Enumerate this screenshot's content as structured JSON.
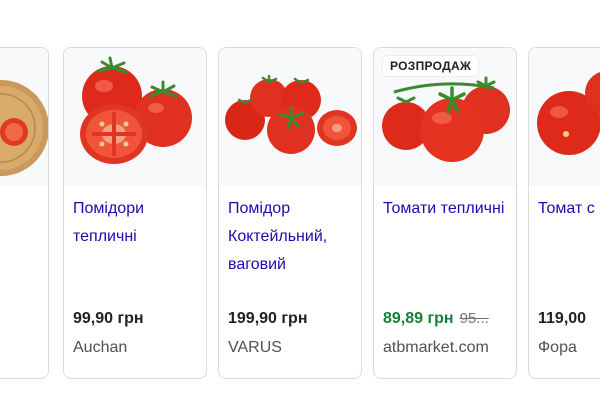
{
  "products": [
    {
      "title": "",
      "price": "",
      "store": "",
      "image": "tomato-on-wooden-board"
    },
    {
      "title": "Помідори тепличні",
      "price": "99,90 грн",
      "store": "Auchan",
      "image": "tomatoes-whole-and-halved"
    },
    {
      "title": "Помідор Коктейльний, ваговий",
      "price": "199,90 грн",
      "store": "VARUS",
      "image": "cocktail-tomatoes"
    },
    {
      "badge": "РОЗПРОДАЖ",
      "title": "Томати тепличні",
      "price": "89,89 грн",
      "old_price": "95...",
      "store": "atbmarket.com",
      "image": "greenhouse-tomatoes-on-vine"
    },
    {
      "title": "Томат с",
      "price": "119,00",
      "store": "Фора",
      "image": "red-tomatoes"
    }
  ],
  "colors": {
    "title_link": "#1a0dab",
    "sale_price": "#188038",
    "tomato_red": "#e02d1c"
  }
}
